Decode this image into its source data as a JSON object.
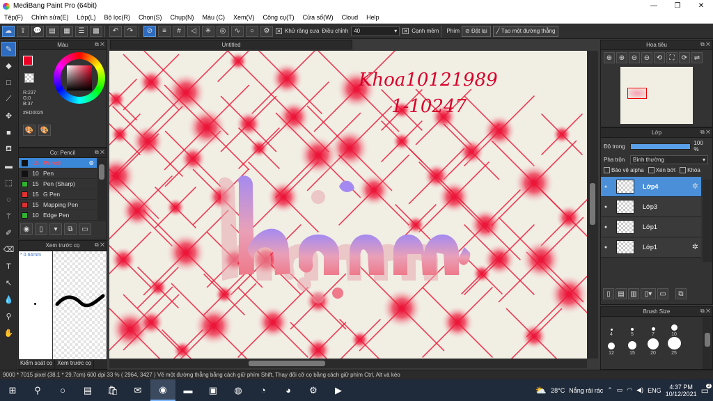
{
  "window": {
    "title": "MediBang Paint Pro (64bit)",
    "minimize": "—",
    "maximize": "❐",
    "close": "✕"
  },
  "menu": [
    "Tệp(F)",
    "Chỉnh sửa(E)",
    "Lớp(L)",
    "Bộ lọc(R)",
    "Chọn(S)",
    "Chụp(N)",
    "Màu (C)",
    "Xem(V)",
    "Công cụ(T)",
    "Cửa sổ(W)",
    "Cloud",
    "Help"
  ],
  "toolbar": {
    "antialias_label": "Khử răng cưa",
    "adjust_label": "Điều chỉnh",
    "adjust_value": "40",
    "snap_label": "Cạnh mềm",
    "key_label": "Phím",
    "reset_label": "Đặt lại",
    "straight_line_label": "Tạo một đường thẳng"
  },
  "color_panel": {
    "title": "Màu",
    "r": "R:237",
    "g": "G:0",
    "b": "B:37",
    "hex": "#ED0025",
    "fg_color": "#ed0025"
  },
  "brush_panel": {
    "title": "Cọ: Pencil",
    "brushes": [
      {
        "size": "15",
        "name": "Pencil",
        "color": "#111"
      },
      {
        "size": "10",
        "name": "Pen",
        "color": "#111"
      },
      {
        "size": "15",
        "name": "Pen (Sharp)",
        "color": "#2db32d"
      },
      {
        "size": "15",
        "name": "G Pen",
        "color": "#e03030"
      },
      {
        "size": "15",
        "name": "Mapping Pen",
        "color": "#e03030"
      },
      {
        "size": "10",
        "name": "Edge Pen",
        "color": "#2db32d"
      }
    ]
  },
  "preview_panel": {
    "title": "Xem trước cọ",
    "size_label": "* 0.64mm"
  },
  "bottom_tabs": [
    "Kiểm soát cọ",
    "Xem trước cọ"
  ],
  "canvas": {
    "tab_title": "Untitled",
    "handwriting_line1": "Khoa10121989",
    "handwriting_line2": "1-10247"
  },
  "navigator": {
    "title": "Hoa tiêu"
  },
  "layers_panel": {
    "title": "Lớp",
    "opacity_label": "Độ trong",
    "opacity_value": "100 %",
    "opacity_fraction": 1.0,
    "blend_label": "Pha trộn",
    "blend_value": "Bình thường",
    "protect_alpha": "Bảo vệ alpha",
    "clipping": "Xén bớt",
    "lock": "Khóa",
    "layers": [
      {
        "name": "Lớp4",
        "selected": true
      },
      {
        "name": "Lớp3",
        "selected": false
      },
      {
        "name": "Lớp1",
        "selected": false
      },
      {
        "name": "Lớp1",
        "selected": false
      }
    ]
  },
  "brush_size_panel": {
    "title": "Brush Size",
    "sizes": [
      "4",
      "5",
      "7",
      "10",
      "12",
      "15",
      "20",
      "25"
    ]
  },
  "status": {
    "text": "9000 * 7015 pixel   (38.1 * 29.7cm)   600 dpi   33 %   ( 2964, 3427 )   Vẽ một đường thẳng bằng cách giữ phím Shift, Thay đổi cỡ cọ bằng cách giữ phím Ctrl, Alt và kéo"
  },
  "taskbar": {
    "weather_temp": "28°C",
    "weather_text": "Nắng rải rác",
    "lang": "ENG",
    "time": "4:37 PM",
    "date": "10/12/2021",
    "notif_count": "2"
  }
}
